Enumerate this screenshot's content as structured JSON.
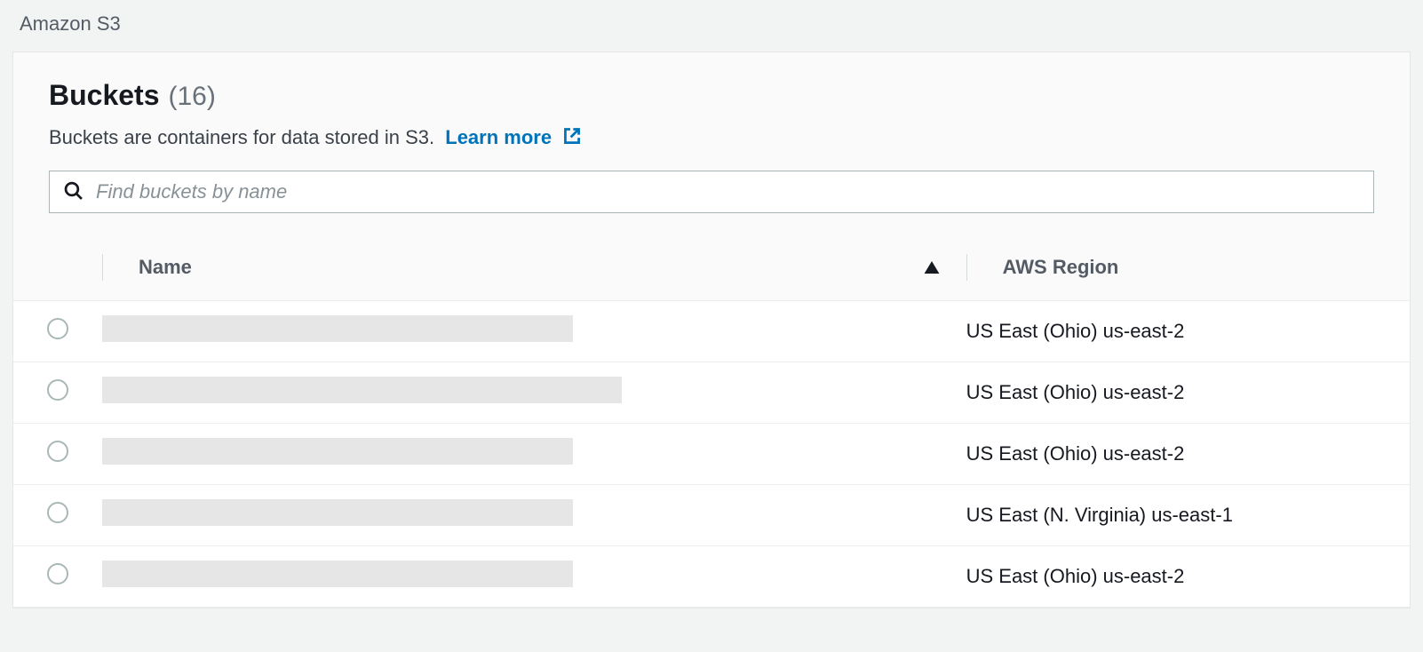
{
  "breadcrumb": "Amazon S3",
  "header": {
    "title": "Buckets",
    "count": "(16)",
    "description": "Buckets are containers for data stored in S3.",
    "learn_more": "Learn more"
  },
  "search": {
    "placeholder": "Find buckets by name"
  },
  "table": {
    "columns": {
      "name": "Name",
      "region": "AWS Region"
    },
    "sort": {
      "column": "name",
      "dir": "asc"
    },
    "rows": [
      {
        "name_redacted": true,
        "name_width": 530,
        "region": "US East (Ohio) us-east-2"
      },
      {
        "name_redacted": true,
        "name_width": 585,
        "region": "US East (Ohio) us-east-2"
      },
      {
        "name_redacted": true,
        "name_width": 530,
        "region": "US East (Ohio) us-east-2"
      },
      {
        "name_redacted": true,
        "name_width": 530,
        "region": "US East (N. Virginia) us-east-1"
      },
      {
        "name_redacted": true,
        "name_width": 530,
        "region": "US East (Ohio) us-east-2"
      }
    ]
  }
}
